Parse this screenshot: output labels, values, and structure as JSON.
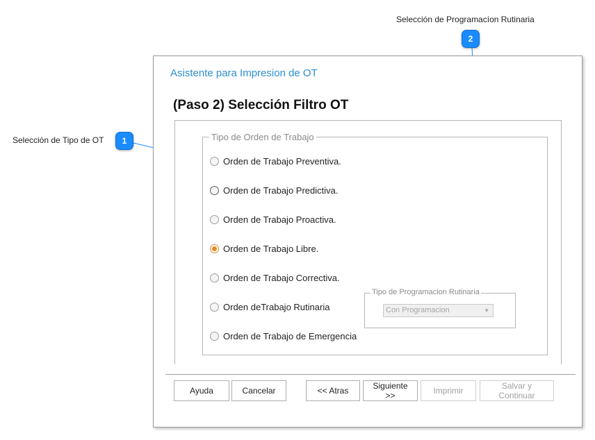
{
  "callouts": [
    {
      "number": "1",
      "label": "Selección de Tipo de OT"
    },
    {
      "number": "2",
      "label": "Selección de Programacíon Rutinaria"
    }
  ],
  "wizard": {
    "title": "Asistente para Impresion de OT",
    "step_title": "(Paso 2)  Selección Filtro OT"
  },
  "ot_group": {
    "legend": "Tipo de Orden de Trabajo",
    "options": [
      {
        "label": "Orden de Trabajo Preventiva.",
        "checked": false
      },
      {
        "label": "Orden de Trabajo Predictiva.",
        "checked": false
      },
      {
        "label": "Orden de Trabajo Proactiva.",
        "checked": false
      },
      {
        "label": "Orden de Trabajo Libre.",
        "checked": true
      },
      {
        "label": "Orden de Trabajo Correctiva.",
        "checked": false
      },
      {
        "label": "Orden deTrabajo Rutinaria",
        "checked": false
      },
      {
        "label": "Orden de Trabajo de Emergencia",
        "checked": false
      }
    ]
  },
  "rutinaria": {
    "legend": "Tipo de Programacion Rutinaria",
    "selected": "Con Programacion"
  },
  "buttons": {
    "help": "Ayuda",
    "cancel": "Cancelar",
    "back": "<< Atras",
    "next": "Siguiente >>",
    "print": "Imprimir",
    "save_continue": "Salvar y Continuar"
  },
  "colors": {
    "badge": "#1a8cff",
    "wizard_title": "#2c8fcf",
    "radio_checked": "#e98b1f"
  }
}
